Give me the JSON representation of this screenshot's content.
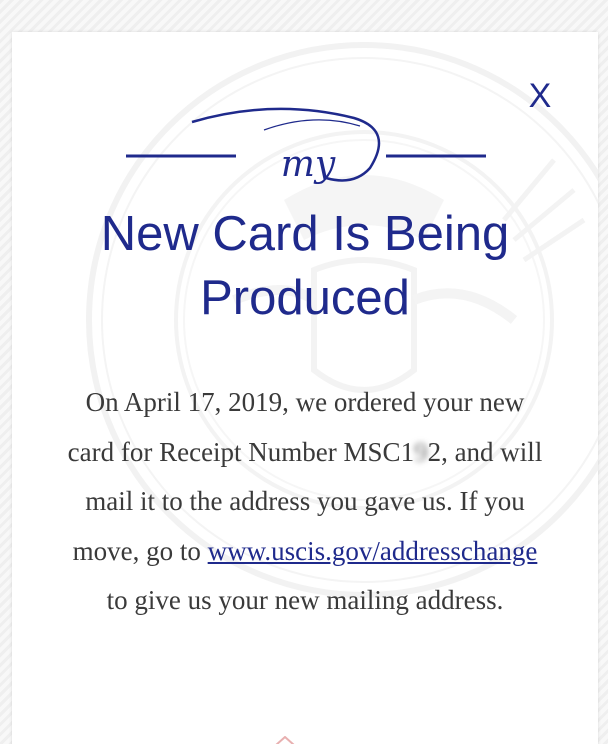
{
  "dialog": {
    "close_label": "X",
    "logo_text": "my",
    "title_line1": "New Card Is Being",
    "title_line2": "Produced",
    "message": {
      "part1": "On April 17, 2019, we ordered your new card for Receipt Number MSC1",
      "receipt_redacted": "9",
      "receipt_tail": "2",
      "part2": ", and will mail it to the address you gave us. If you move, go to ",
      "link_text": "www.uscis.gov/addresschange",
      "part3": " to give us your new mailing address."
    }
  },
  "colors": {
    "brand_blue": "#1f2a8c",
    "body_text": "#3a3a3a",
    "card_background": "#ffffff"
  },
  "icons": {
    "close": "close-icon",
    "logo": "my-uscis-logo",
    "watermark": "dhs-seal-watermark"
  }
}
